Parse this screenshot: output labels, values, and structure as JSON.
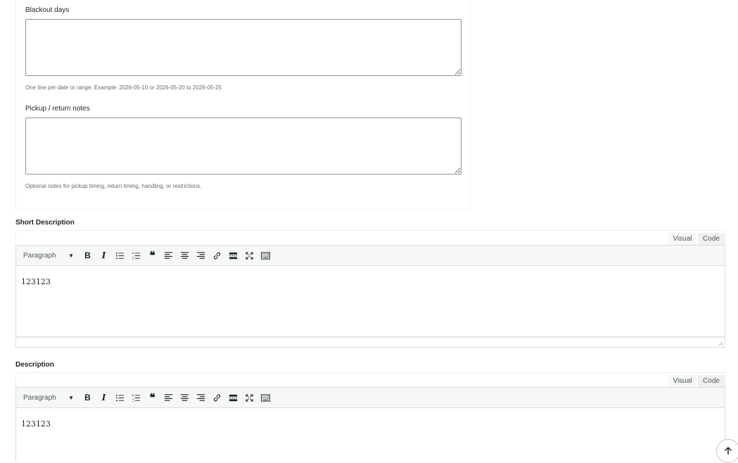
{
  "fields": {
    "blackout": {
      "label": "Blackout days",
      "value": "",
      "help": "One line per date or range. Example: 2026-05-10 or 2026-05-20 to 2026-05-25"
    },
    "pickup": {
      "label": "Pickup / return notes",
      "value": "",
      "help": "Optional notes for pickup timing, return timing, handling, or restrictions."
    }
  },
  "short_description": {
    "title": "Short Description",
    "tabs": {
      "visual": "Visual",
      "code": "Code"
    },
    "format_select": "Paragraph",
    "content": "123123"
  },
  "description": {
    "title": "Description",
    "tabs": {
      "visual": "Visual",
      "code": "Code"
    },
    "format_select": "Paragraph",
    "content": "123123"
  },
  "toolbar_icons": [
    "bold-icon",
    "italic-icon",
    "bulleted-list-icon",
    "numbered-list-icon",
    "blockquote-icon",
    "align-left-icon",
    "align-center-icon",
    "align-right-icon",
    "link-icon",
    "read-more-icon",
    "fullscreen-icon",
    "toolbar-toggle-icon"
  ],
  "colors": {
    "border": "#dcdcde",
    "toolbar_bg": "#f6f7f7",
    "text": "#1d2327",
    "muted": "#646970"
  }
}
